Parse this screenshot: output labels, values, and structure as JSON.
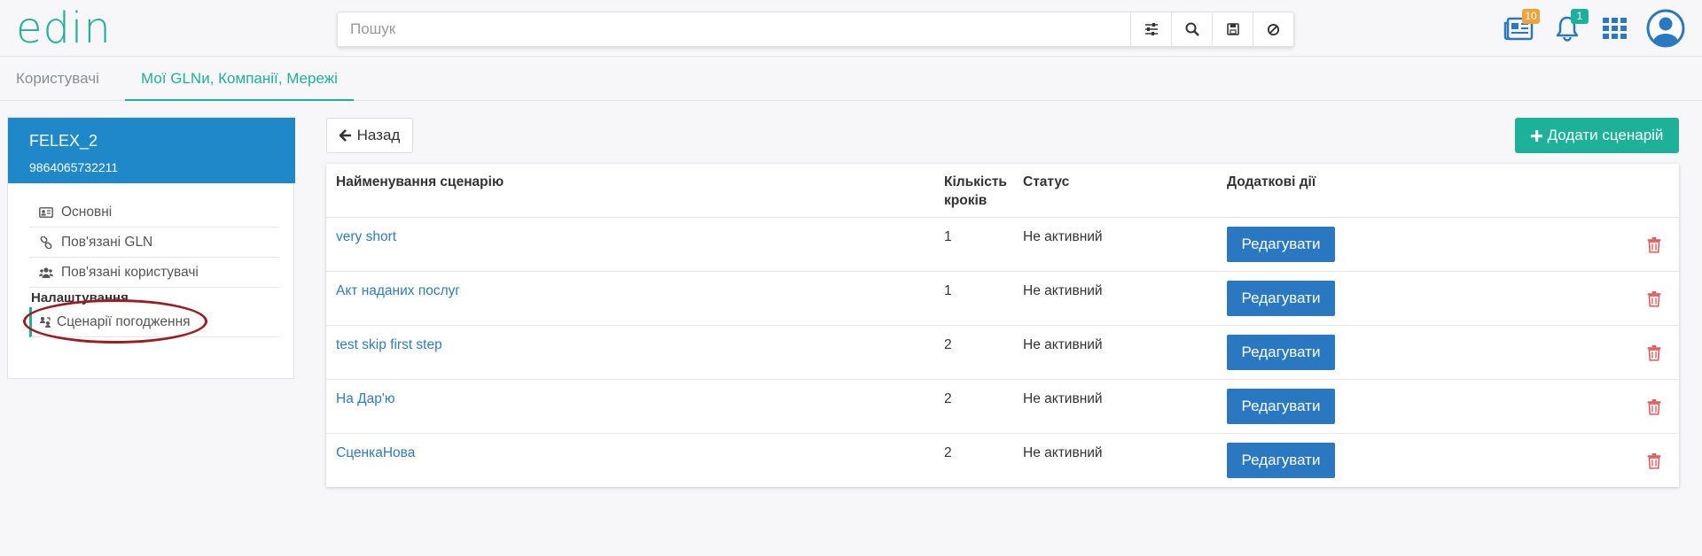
{
  "header": {
    "logo_text": "edin",
    "search_placeholder": "Пошук",
    "news_badge": "10",
    "notifications_badge": "1"
  },
  "tabs": [
    {
      "label": "Користувачі",
      "active": false
    },
    {
      "label": "Мої GLNи, Компанії, Мережі",
      "active": true
    }
  ],
  "sidebar": {
    "title": "FELEX_2",
    "gln": "9864065732211",
    "items": [
      {
        "label": "Основні",
        "icon": "id-card-icon"
      },
      {
        "label": "Пов'язані GLN",
        "icon": "link-icon"
      },
      {
        "label": "Пов'язані користувачі",
        "icon": "users-icon"
      }
    ],
    "section_title": "Налаштування",
    "section_items": [
      {
        "label": "Сценарії погодження",
        "icon": "approval-scenario-icon",
        "active": true
      }
    ]
  },
  "main": {
    "back_label": "Назад",
    "add_label": "Додати сценарій",
    "columns": {
      "name": "Найменування сценарію",
      "steps": "Кількість кроків",
      "status": "Статус",
      "actions": "Додаткові дії"
    },
    "edit_label": "Редагувати",
    "rows": [
      {
        "name": "very short",
        "steps": "1",
        "status": "Не активний"
      },
      {
        "name": "Акт наданих послуг",
        "steps": "1",
        "status": "Не активний"
      },
      {
        "name": "test skip first step",
        "steps": "2",
        "status": "Не активний"
      },
      {
        "name": "На Дар'ю",
        "steps": "2",
        "status": "Не активний"
      },
      {
        "name": "СценкаНова",
        "steps": "2",
        "status": "Не активний"
      }
    ]
  },
  "colors": {
    "brand": "#1db19a",
    "sidebar_header": "#1e88c9",
    "edit_button": "#2b78c2",
    "delete_icon": "#e05a5a",
    "annotation": "#9b1c23"
  }
}
